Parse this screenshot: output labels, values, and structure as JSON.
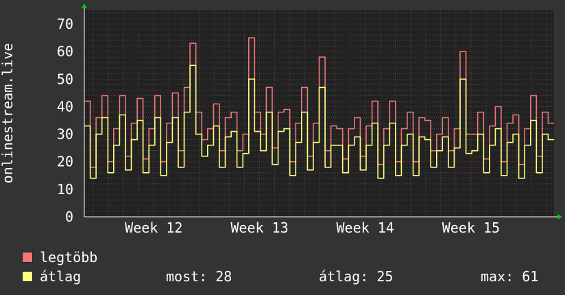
{
  "colors": {
    "background": "#333333",
    "plot_background": "#222222",
    "grid_major": "#7a3030",
    "grid_minor": "#4a4a4a",
    "axis_arrow": "#00cc00",
    "max_line": "#f07878",
    "avg_line": "#ffff80",
    "text": "#ffffff"
  },
  "legend": {
    "max_label": "legtöbb",
    "avg_label": "átlag"
  },
  "stats": {
    "current": "most: 28",
    "average": "átlag: 25",
    "maximum": "max: 61"
  },
  "chart_data": {
    "type": "line",
    "ylabel": "onlinestream.live",
    "ylim": [
      0,
      75
    ],
    "yticks": [
      0,
      10,
      20,
      30,
      40,
      50,
      60,
      70
    ],
    "xtick_labels": [
      "Week 12",
      "Week 13",
      "Week 14",
      "Week 15"
    ],
    "xtick_positions": [
      4,
      11,
      18,
      25
    ],
    "x_range": [
      -0.6,
      30.5
    ],
    "grid": true,
    "series": [
      {
        "name": "legtöbb",
        "values": [
          42,
          18,
          36,
          44,
          20,
          32,
          44,
          22,
          34,
          43,
          21,
          32,
          44,
          20,
          34,
          45,
          24,
          47,
          63,
          38,
          28,
          32,
          41,
          24,
          36,
          38,
          24,
          30,
          65,
          38,
          30,
          47,
          25,
          38,
          39,
          20,
          34,
          47,
          22,
          34,
          58,
          24,
          33,
          32,
          21,
          32,
          36,
          22,
          33,
          42,
          19,
          32,
          42,
          20,
          32,
          38,
          20,
          36,
          35,
          24,
          30,
          36,
          24,
          32,
          60,
          30,
          30,
          38,
          21,
          33,
          40,
          20,
          34,
          37,
          19,
          32,
          44,
          22,
          38,
          34
        ]
      },
      {
        "name": "átlag",
        "values": [
          33,
          14,
          30,
          36,
          16,
          26,
          37,
          17,
          28,
          35,
          16,
          26,
          36,
          15,
          27,
          36,
          18,
          38,
          55,
          30,
          22,
          26,
          33,
          18,
          29,
          31,
          18,
          23,
          50,
          31,
          24,
          38,
          19,
          31,
          32,
          15,
          27,
          38,
          17,
          27,
          47,
          18,
          26,
          26,
          16,
          26,
          29,
          17,
          26,
          34,
          14,
          26,
          34,
          15,
          26,
          30,
          15,
          29,
          28,
          18,
          24,
          29,
          18,
          25,
          50,
          23,
          24,
          30,
          16,
          26,
          32,
          15,
          27,
          30,
          14,
          26,
          35,
          16,
          30,
          28
        ]
      }
    ]
  }
}
